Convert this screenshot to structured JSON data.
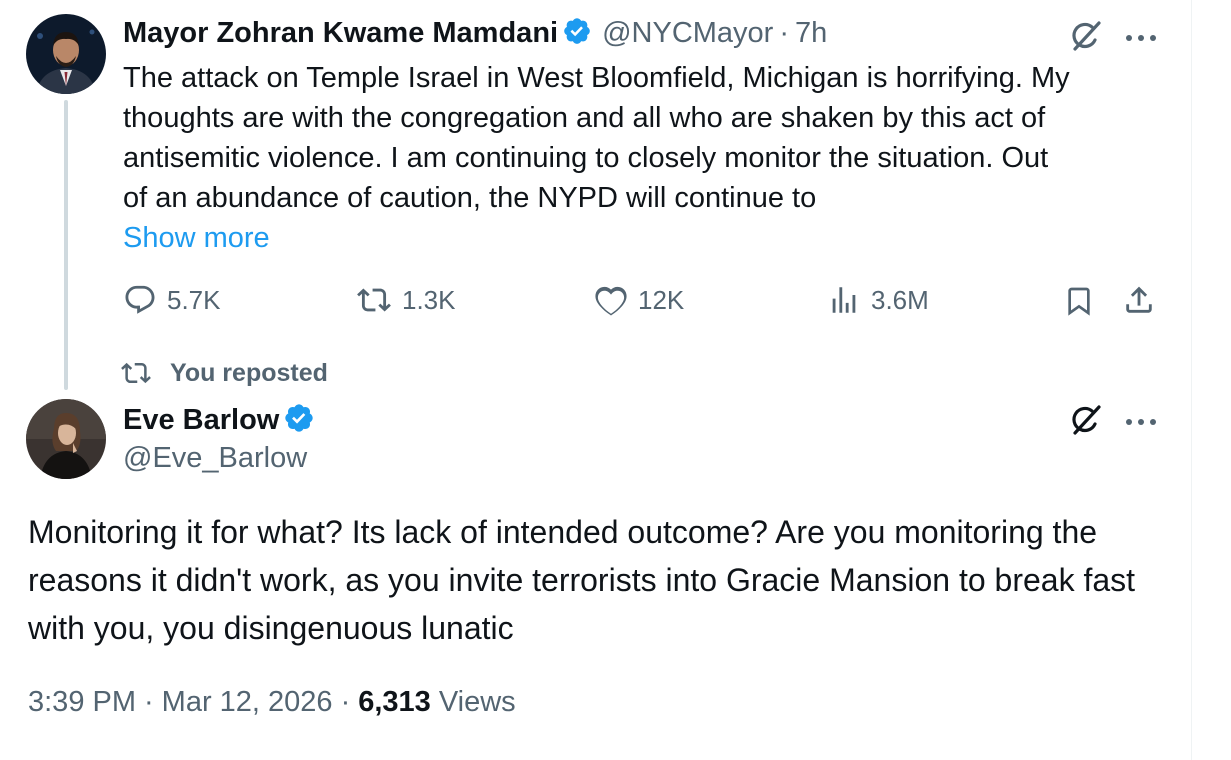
{
  "parent_tweet": {
    "author_name": "Mayor Zohran Kwame Mamdani",
    "handle": "@NYCMayor",
    "separator": "·",
    "time": "7h",
    "text_lines": [
      "The attack on Temple Israel in West Bloomfield, Michigan is horrifying. My",
      "thoughts are with the congregation and all who are shaken by this act of",
      "antisemitic violence. I am continuing to closely monitor the situation. Out",
      "of an abundance of caution, the NYPD will continue to"
    ],
    "show_more": "Show more",
    "replies": "5.7K",
    "reposts": "1.3K",
    "likes": "12K",
    "views": "3.6M"
  },
  "repost_indicator": "You reposted",
  "main_tweet": {
    "author_name": "Eve Barlow",
    "handle": "@Eve_Barlow",
    "text": "Monitoring it for what? Its lack of intended outcome? Are you monitoring the reasons it didn't work, as you invite terrorists into Gracie Mansion to break fast with you, you disingenuous lunatic",
    "time": "3:39 PM",
    "date": "Mar 12, 2026",
    "dot": "·",
    "views_count": "6,313",
    "views_label": "Views"
  },
  "colors": {
    "accent": "#1d9bf0",
    "muted": "#536471",
    "text": "#0f1419",
    "thread_line": "#cfd9de"
  }
}
